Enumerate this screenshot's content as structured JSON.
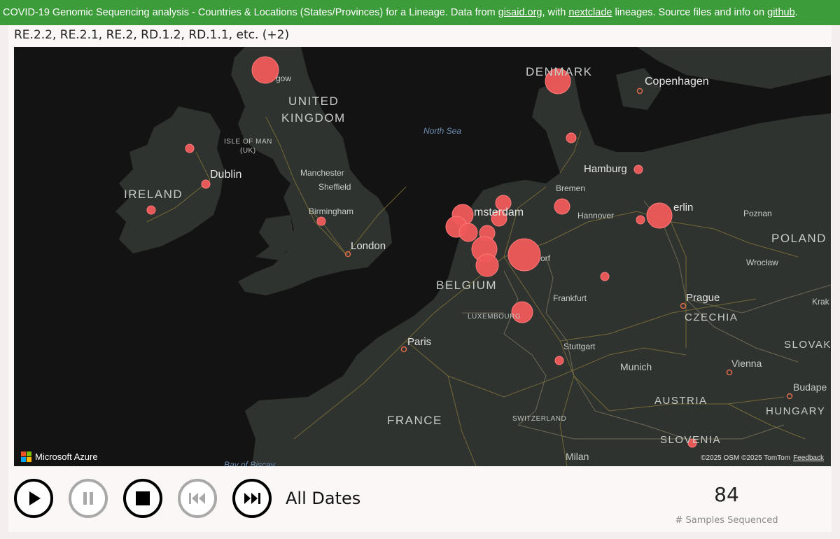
{
  "banner": {
    "text_1": "COVID-19 Genomic Sequencing analysis - Countries & Locations (States/Provinces)  for a Lineage. Data from ",
    "link_gisaid": "gisaid.org",
    "text_2": ", with ",
    "link_nextclade": "nextclade",
    "text_3": " lineages. Source files and info on ",
    "link_github": "github",
    "text_4": "."
  },
  "lineage_filter": "RE.2.2, RE.2.1, RE.2, RD.1.2, RD.1.1, etc. (+2)",
  "map": {
    "background_color": "#2f332f",
    "water_color": "#131313",
    "bubble_color": "#f05a5a",
    "countries": {
      "uk_line1": "UNITED",
      "uk_line2": "KINGDOM",
      "ireland": "IRELAND",
      "isle_of_man_line1": "ISLE OF MAN",
      "isle_of_man_line2": "(UK)",
      "denmark": "DENMARK",
      "belgium": "BELGIUM",
      "luxembourg": "LUXEMBOURG",
      "france": "FRANCE",
      "switzerland": "SWITZERLAND",
      "austria": "AUSTRIA",
      "czechia": "CZECHIA",
      "slovakia": "SLOVAK",
      "hungary": "HUNGARY",
      "slovenia": "SLOVENIA",
      "poland": "POLAND"
    },
    "cities": {
      "glasgow": "gow",
      "dublin": "Dublin",
      "manchester": "Manchester",
      "sheffield": "Sheffield",
      "birmingham": "Birmingham",
      "london": "London",
      "copenhagen": "Copenhagen",
      "hamburg": "Hamburg",
      "bremen": "Bremen",
      "amsterdam_start": "msterdam",
      "hannover": "Hannover",
      "berlin": "erlin",
      "poznan": "Poznan",
      "wroclaw": "Wrocław",
      "dusseldorf_end": "orf",
      "frankfurt": "Frankfurt",
      "prague": "Prague",
      "krakow": "Krak",
      "paris": "Paris",
      "stuttgart": "Stuttgart",
      "munich": "Munich",
      "vienna": "Vienna",
      "budapest": "Budape",
      "milan": "Milan"
    },
    "seas": {
      "north_sea": "North Sea",
      "bay_of_biscay": "Bay of Biscay"
    },
    "branding": "Microsoft Azure",
    "attribution": "©2025 OSM  ©2025 TomTom",
    "feedback": "Feedback"
  },
  "playback": {
    "play_icon": "play-icon",
    "pause_icon": "pause-icon",
    "stop_icon": "stop-icon",
    "previous_icon": "skip-previous-icon",
    "next_icon": "skip-next-icon",
    "date_label": "All Dates"
  },
  "samples": {
    "count": "84",
    "label": "# Samples Sequenced"
  }
}
